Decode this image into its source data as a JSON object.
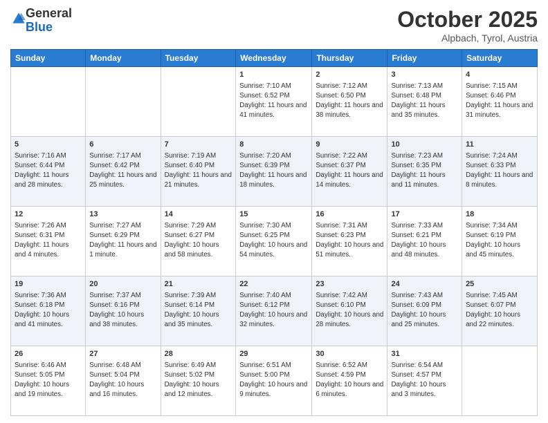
{
  "logo": {
    "general": "General",
    "blue": "Blue"
  },
  "header": {
    "month": "October 2025",
    "location": "Alpbach, Tyrol, Austria"
  },
  "weekdays": [
    "Sunday",
    "Monday",
    "Tuesday",
    "Wednesday",
    "Thursday",
    "Friday",
    "Saturday"
  ],
  "weeks": [
    [
      {
        "day": "",
        "info": ""
      },
      {
        "day": "",
        "info": ""
      },
      {
        "day": "",
        "info": ""
      },
      {
        "day": "1",
        "info": "Sunrise: 7:10 AM\nSunset: 6:52 PM\nDaylight: 11 hours and 41 minutes."
      },
      {
        "day": "2",
        "info": "Sunrise: 7:12 AM\nSunset: 6:50 PM\nDaylight: 11 hours and 38 minutes."
      },
      {
        "day": "3",
        "info": "Sunrise: 7:13 AM\nSunset: 6:48 PM\nDaylight: 11 hours and 35 minutes."
      },
      {
        "day": "4",
        "info": "Sunrise: 7:15 AM\nSunset: 6:46 PM\nDaylight: 11 hours and 31 minutes."
      }
    ],
    [
      {
        "day": "5",
        "info": "Sunrise: 7:16 AM\nSunset: 6:44 PM\nDaylight: 11 hours and 28 minutes."
      },
      {
        "day": "6",
        "info": "Sunrise: 7:17 AM\nSunset: 6:42 PM\nDaylight: 11 hours and 25 minutes."
      },
      {
        "day": "7",
        "info": "Sunrise: 7:19 AM\nSunset: 6:40 PM\nDaylight: 11 hours and 21 minutes."
      },
      {
        "day": "8",
        "info": "Sunrise: 7:20 AM\nSunset: 6:39 PM\nDaylight: 11 hours and 18 minutes."
      },
      {
        "day": "9",
        "info": "Sunrise: 7:22 AM\nSunset: 6:37 PM\nDaylight: 11 hours and 14 minutes."
      },
      {
        "day": "10",
        "info": "Sunrise: 7:23 AM\nSunset: 6:35 PM\nDaylight: 11 hours and 11 minutes."
      },
      {
        "day": "11",
        "info": "Sunrise: 7:24 AM\nSunset: 6:33 PM\nDaylight: 11 hours and 8 minutes."
      }
    ],
    [
      {
        "day": "12",
        "info": "Sunrise: 7:26 AM\nSunset: 6:31 PM\nDaylight: 11 hours and 4 minutes."
      },
      {
        "day": "13",
        "info": "Sunrise: 7:27 AM\nSunset: 6:29 PM\nDaylight: 11 hours and 1 minute."
      },
      {
        "day": "14",
        "info": "Sunrise: 7:29 AM\nSunset: 6:27 PM\nDaylight: 10 hours and 58 minutes."
      },
      {
        "day": "15",
        "info": "Sunrise: 7:30 AM\nSunset: 6:25 PM\nDaylight: 10 hours and 54 minutes."
      },
      {
        "day": "16",
        "info": "Sunrise: 7:31 AM\nSunset: 6:23 PM\nDaylight: 10 hours and 51 minutes."
      },
      {
        "day": "17",
        "info": "Sunrise: 7:33 AM\nSunset: 6:21 PM\nDaylight: 10 hours and 48 minutes."
      },
      {
        "day": "18",
        "info": "Sunrise: 7:34 AM\nSunset: 6:19 PM\nDaylight: 10 hours and 45 minutes."
      }
    ],
    [
      {
        "day": "19",
        "info": "Sunrise: 7:36 AM\nSunset: 6:18 PM\nDaylight: 10 hours and 41 minutes."
      },
      {
        "day": "20",
        "info": "Sunrise: 7:37 AM\nSunset: 6:16 PM\nDaylight: 10 hours and 38 minutes."
      },
      {
        "day": "21",
        "info": "Sunrise: 7:39 AM\nSunset: 6:14 PM\nDaylight: 10 hours and 35 minutes."
      },
      {
        "day": "22",
        "info": "Sunrise: 7:40 AM\nSunset: 6:12 PM\nDaylight: 10 hours and 32 minutes."
      },
      {
        "day": "23",
        "info": "Sunrise: 7:42 AM\nSunset: 6:10 PM\nDaylight: 10 hours and 28 minutes."
      },
      {
        "day": "24",
        "info": "Sunrise: 7:43 AM\nSunset: 6:09 PM\nDaylight: 10 hours and 25 minutes."
      },
      {
        "day": "25",
        "info": "Sunrise: 7:45 AM\nSunset: 6:07 PM\nDaylight: 10 hours and 22 minutes."
      }
    ],
    [
      {
        "day": "26",
        "info": "Sunrise: 6:46 AM\nSunset: 5:05 PM\nDaylight: 10 hours and 19 minutes."
      },
      {
        "day": "27",
        "info": "Sunrise: 6:48 AM\nSunset: 5:04 PM\nDaylight: 10 hours and 16 minutes."
      },
      {
        "day": "28",
        "info": "Sunrise: 6:49 AM\nSunset: 5:02 PM\nDaylight: 10 hours and 12 minutes."
      },
      {
        "day": "29",
        "info": "Sunrise: 6:51 AM\nSunset: 5:00 PM\nDaylight: 10 hours and 9 minutes."
      },
      {
        "day": "30",
        "info": "Sunrise: 6:52 AM\nSunset: 4:59 PM\nDaylight: 10 hours and 6 minutes."
      },
      {
        "day": "31",
        "info": "Sunrise: 6:54 AM\nSunset: 4:57 PM\nDaylight: 10 hours and 3 minutes."
      },
      {
        "day": "",
        "info": ""
      }
    ]
  ]
}
